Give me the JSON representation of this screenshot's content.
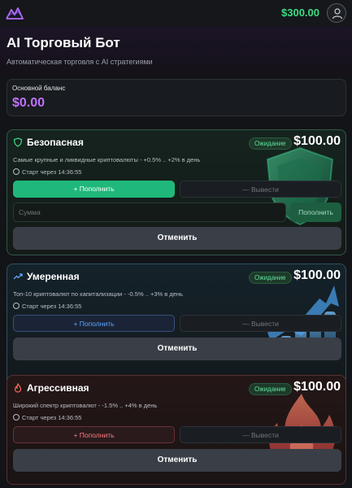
{
  "header": {
    "balance": "$300.00",
    "logo_icon": "mountain-logo-icon",
    "avatar_icon": "user-icon"
  },
  "page": {
    "title": "AI Торговый Бот",
    "subtitle": "Автоматическая торговля с AI стратегиями"
  },
  "balance_card": {
    "label": "Основной баланс",
    "value": "$0.00"
  },
  "strategies": [
    {
      "name": "Безопасная",
      "icon": "shield-icon",
      "status": "Ожидание",
      "amount": "$100.00",
      "description": "Самые крупные и ликвидные криптовалюты - +0.5% .. +2% в день",
      "start": "Старт через 14:36:55",
      "deposit_label": "+ Пополнить",
      "withdraw_label": "— Вывести",
      "amount_placeholder": "Сумма",
      "submit_label": "Пополнить",
      "cancel_label": "Отменить",
      "accent": "#1fb87a"
    },
    {
      "name": "Умеренная",
      "icon": "trending-up-icon",
      "status": "Ожидание",
      "amount": "$100.00",
      "description": "Топ-10 криптовалют по капитализации - -0.5% .. +3% в день",
      "start": "Старт через 14:36:55",
      "deposit_label": "+ Пополнить",
      "withdraw_label": "— Вывести",
      "cancel_label": "Отменить",
      "accent": "#5fa6ff"
    },
    {
      "name": "Агрессивная",
      "icon": "flame-icon",
      "status": "Ожидание",
      "amount": "$100.00",
      "description": "Широкий спектр криптовалют - -1.5% .. +4% в день",
      "start": "Старт через 14:36:55",
      "deposit_label": "+ Пополнить",
      "withdraw_label": "— Вывести",
      "cancel_label": "Отменить",
      "accent": "#ff7a7a"
    }
  ]
}
